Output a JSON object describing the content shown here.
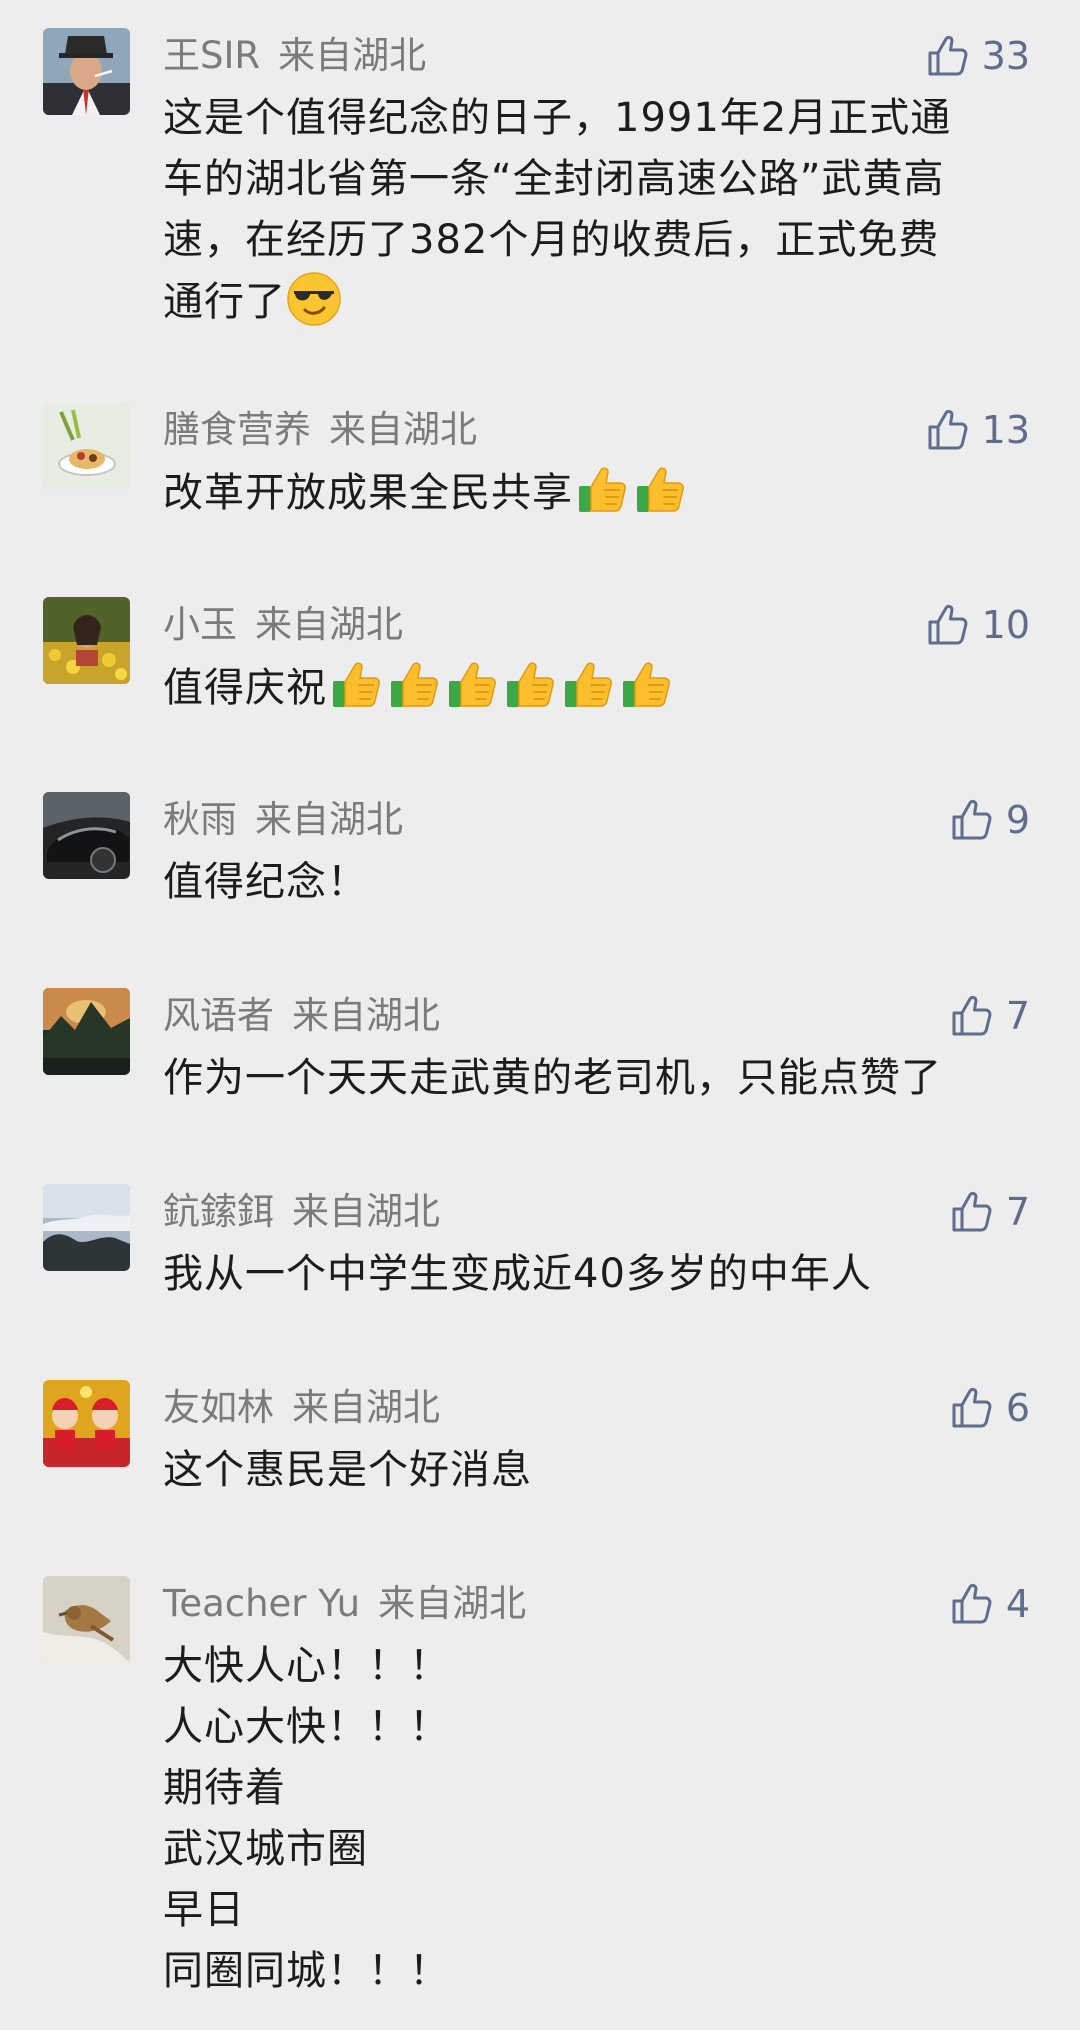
{
  "colors": {
    "background": "#ededed",
    "name": "#7b7b7b",
    "like": "#5f6d8d",
    "text": "#1c1c1c"
  },
  "comments": [
    {
      "name": "王SIR",
      "location": "来自湖北",
      "likes": "33",
      "lines": [
        "这是个值得纪念的日子，1991年2月正式通",
        "车的湖北省第一条“全封闭高速公路”武黄高",
        "速，在经历了382个月的收费后，正式免费",
        "通行了"
      ],
      "avatar_icon": "man-in-hat-avatar",
      "trailing_emoji": "sunglasses-emoji"
    },
    {
      "name": "膳食营养",
      "location": "来自湖北",
      "likes": "13",
      "lines": [
        "改革开放成果全民共享"
      ],
      "avatar_icon": "food-bowl-avatar",
      "trailing_emoji": "thumbs-up-emoji",
      "emoji_count": 2
    },
    {
      "name": "小玉",
      "location": "来自湖北",
      "likes": "10",
      "lines": [
        "值得庆祝"
      ],
      "avatar_icon": "flower-field-avatar",
      "trailing_emoji": "thumbs-up-emoji",
      "emoji_count": 6
    },
    {
      "name": "秋雨",
      "location": "来自湖北",
      "likes": "9",
      "lines": [
        "值得纪念！"
      ],
      "avatar_icon": "sports-car-avatar"
    },
    {
      "name": "风语者",
      "location": "来自湖北",
      "likes": "7",
      "lines": [
        "作为一个天天走武黄的老司机，只能点赞了"
      ],
      "avatar_icon": "mountain-sunset-avatar"
    },
    {
      "name": "鈧鎍鉺",
      "location": "来自湖北",
      "likes": "7",
      "lines": [
        "我从一个中学生变成近40多岁的中年人"
      ],
      "avatar_icon": "sea-of-clouds-avatar"
    },
    {
      "name": "友如林",
      "location": "来自湖北",
      "likes": "6",
      "lines": [
        "这个惠民是个好消息"
      ],
      "avatar_icon": "festive-cartoon-avatar"
    },
    {
      "name": "Teacher Yu",
      "location": "来自湖北",
      "likes": "4",
      "lines": [
        "大快人心！！！",
        "人心大快！！！",
        "期待着",
        "武汉城市圈",
        "早日",
        "同圈同城！！！"
      ],
      "avatar_icon": "bird-avatar"
    }
  ]
}
